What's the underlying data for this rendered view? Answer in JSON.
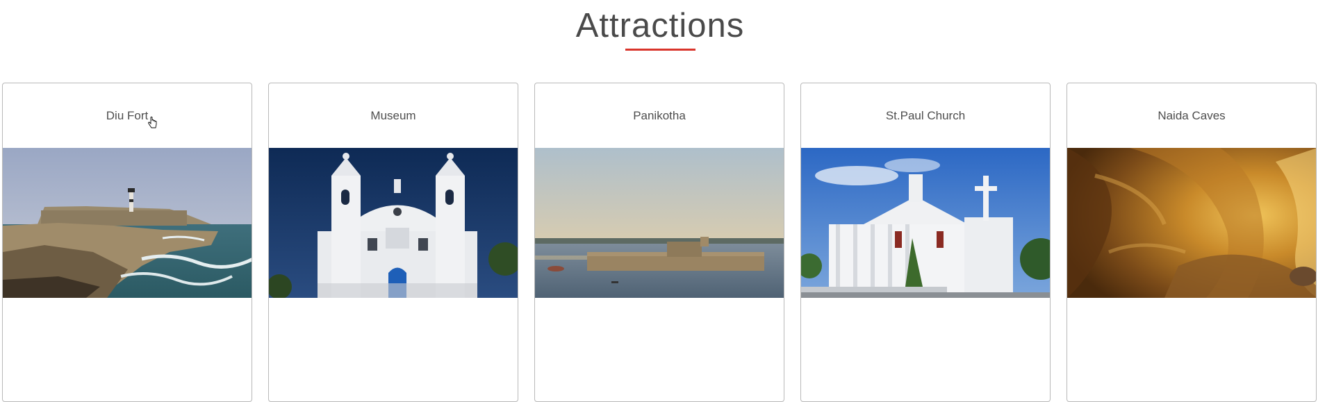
{
  "section": {
    "title": "Attractions",
    "accent_color": "#d9342b"
  },
  "cards": [
    {
      "title": "Diu Fort",
      "image": "fort-on-rocky-coast"
    },
    {
      "title": "Museum",
      "image": "white-church-facade"
    },
    {
      "title": "Panikotha",
      "image": "sea-fort-in-water"
    },
    {
      "title": "St.Paul Church",
      "image": "white-baroque-church"
    },
    {
      "title": "Naida Caves",
      "image": "golden-cave-walls"
    }
  ]
}
